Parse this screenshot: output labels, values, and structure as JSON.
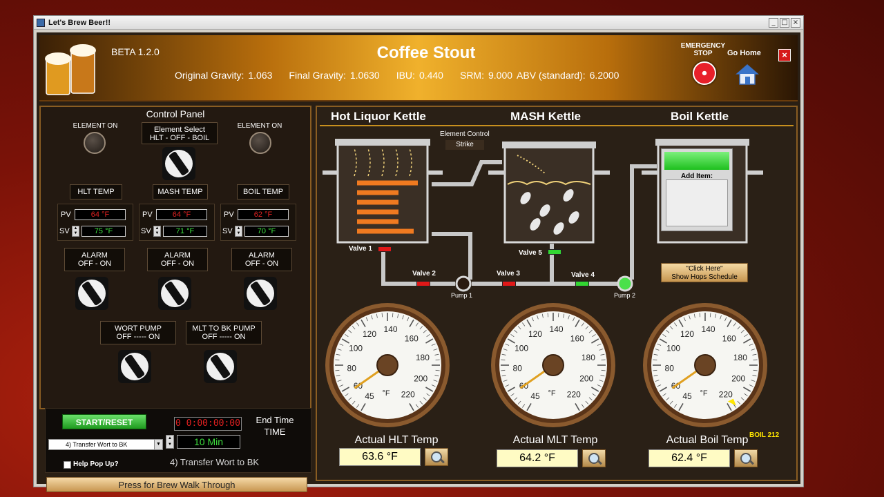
{
  "window": {
    "title": "Let's Brew Beer!!",
    "min": "_",
    "max": "□",
    "close": "×"
  },
  "header": {
    "beta": "BETA 1.2.0",
    "recipe": "Coffee Stout",
    "og_label": "Original Gravity:",
    "og": "1.063",
    "fg_label": "Final Gravity:",
    "fg": "1.0630",
    "ibu_label": "IBU:",
    "ibu": "0.440",
    "srm_label": "SRM:",
    "srm": "9.000",
    "abv_label": "ABV (standard):",
    "abv": "6.2000",
    "estop": "EMERGENCY STOP",
    "gohome": "Go Home",
    "close": "×"
  },
  "control": {
    "title": "Control Panel",
    "element_on": "ELEMENT ON",
    "element_select": "Element Select",
    "element_select_opts": "HLT  - OFF - BOIL",
    "hlt_temp": "HLT TEMP",
    "mash_temp": "MASH TEMP",
    "boil_temp": "BOIL TEMP",
    "pv": "PV",
    "sv": "SV",
    "hlt_pv": "64 °F",
    "hlt_sv": "75 °F",
    "mash_pv": "64 °F",
    "mash_sv": "71 °F",
    "boil_pv": "62 °F",
    "boil_sv": "70 °F",
    "alarm": "ALARM",
    "alarm_opts": "OFF   -   ON",
    "wort_pump": "WORT PUMP",
    "wort_pump_opts": "OFF  -----  ON",
    "mlt_pump": "MLT TO BK PUMP",
    "mlt_pump_opts": "OFF  -----  ON"
  },
  "bottom": {
    "start": "START/RESET",
    "timer": "0 0:00:00:00",
    "end_time": "End Time",
    "end_time_val": "TIME",
    "step_select": "4) Transfer Wort to BK",
    "minutes": "10 Min",
    "help": "Help Pop Up?",
    "step_label": "4) Transfer Wort to BK",
    "walk": "Press for Brew Walk Through"
  },
  "process": {
    "hlt": "Hot Liquor Kettle",
    "mash": "MASH Kettle",
    "boil": "Boil Kettle",
    "element_control": "Element Control",
    "strike": "Strike",
    "add_item": "Add Item:",
    "hops_btn_1": "\"Click Here\"",
    "hops_btn_2": "Show Hops Schedule",
    "valve1": "Valve 1",
    "valve2": "Valve 2",
    "valve3": "Valve 3",
    "valve4": "Valve 4",
    "valve5": "Valve 5",
    "pump1": "Pump 1",
    "pump2": "Pump 2"
  },
  "gauges": [
    {
      "label": "Actual HLT Temp",
      "value": "63.6 °F"
    },
    {
      "label": "Actual MLT Temp",
      "value": "64.2 °F"
    },
    {
      "label": "Actual Boil Temp",
      "value": "62.4 °F"
    }
  ],
  "gauge_ticks": [
    "45",
    "60",
    "80",
    "100",
    "120",
    "140",
    "160",
    "180",
    "200",
    "220"
  ],
  "gauge_unit": "°F",
  "boil_marker": "BOIL 212",
  "colors": {
    "valve_red": "#e01818",
    "valve_green": "#32d632",
    "accent": "#8a5d22"
  }
}
